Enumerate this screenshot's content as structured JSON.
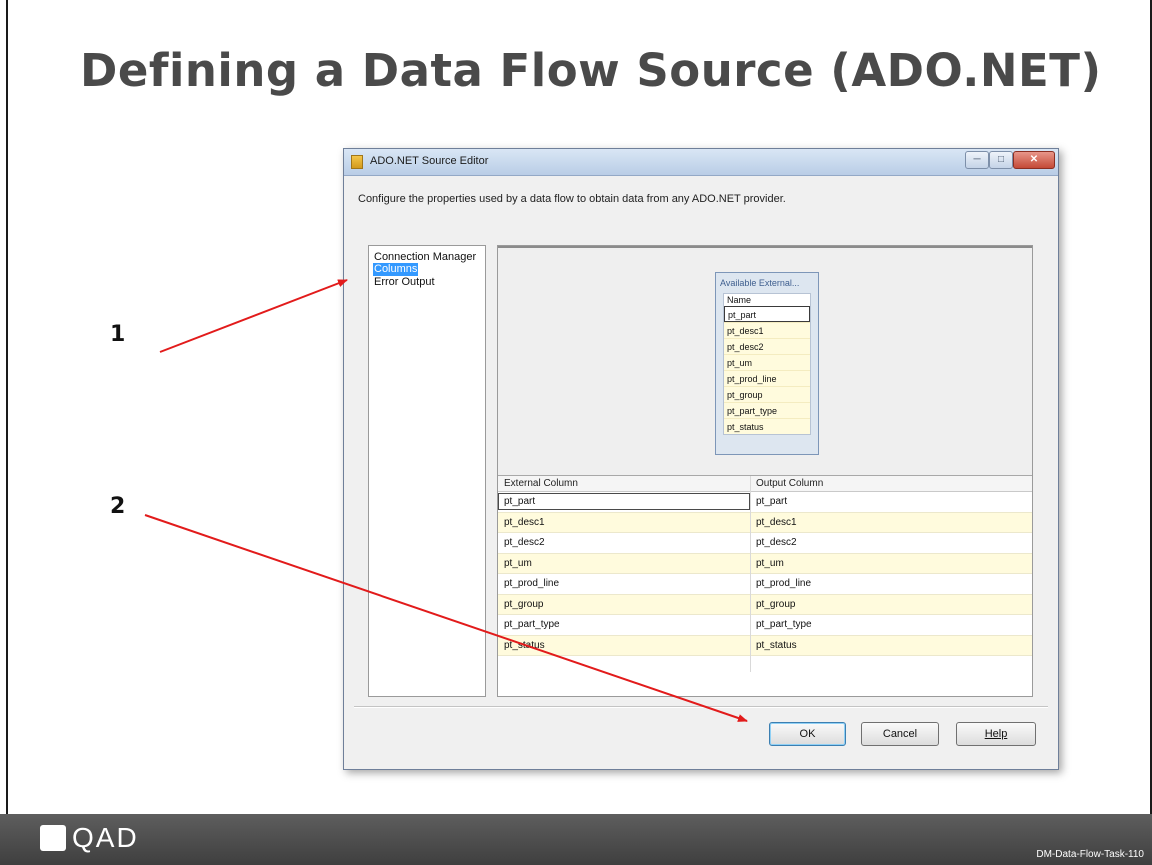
{
  "slide": {
    "title": "Defining a Data Flow Source (ADO.NET)",
    "callout_1": "1",
    "callout_2": "2",
    "logo_text": "QAD",
    "slide_id": "DM-Data-Flow-Task-110"
  },
  "dialog": {
    "title": "ADO.NET Source Editor",
    "description": "Configure the properties used by a data flow to obtain data from any ADO.NET provider.",
    "nav": [
      {
        "label": "Connection Manager",
        "active": false
      },
      {
        "label": "Columns",
        "active": true
      },
      {
        "label": "Error Output",
        "active": false
      }
    ],
    "available_columns": {
      "title": "Available External...",
      "header": "Name",
      "items": [
        "pt_part",
        "pt_desc1",
        "pt_desc2",
        "pt_um",
        "pt_prod_line",
        "pt_group",
        "pt_part_type",
        "pt_status"
      ]
    },
    "grid": {
      "headers": [
        "External Column",
        "Output Column"
      ],
      "rows": [
        [
          "pt_part",
          "pt_part"
        ],
        [
          "pt_desc1",
          "pt_desc1"
        ],
        [
          "pt_desc2",
          "pt_desc2"
        ],
        [
          "pt_um",
          "pt_um"
        ],
        [
          "pt_prod_line",
          "pt_prod_line"
        ],
        [
          "pt_group",
          "pt_group"
        ],
        [
          "pt_part_type",
          "pt_part_type"
        ],
        [
          "pt_status",
          "pt_status"
        ]
      ]
    },
    "buttons": {
      "ok": "OK",
      "cancel": "Cancel",
      "help": "Help"
    }
  },
  "colors": {
    "arrow": "#e21b1b",
    "selection": "#3399ff",
    "row_alt": "#fffbdd"
  }
}
